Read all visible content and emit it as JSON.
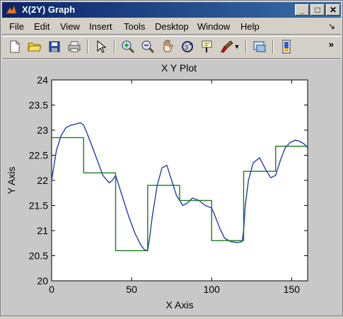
{
  "window": {
    "title": "X(2Y)  Graph",
    "controls": {
      "minimize": "_",
      "maximize": "□",
      "close": "✕"
    }
  },
  "menu": {
    "items": [
      "File",
      "Edit",
      "View",
      "Insert",
      "Tools",
      "Desktop",
      "Window",
      "Help"
    ],
    "dock_glyph": "↘"
  },
  "toolbar": {
    "icons": [
      "new-figure-icon",
      "open-file-icon",
      "save-icon",
      "print-icon",
      "pointer-icon",
      "zoom-in-icon",
      "zoom-out-icon",
      "pan-icon",
      "rotate-3d-icon",
      "data-cursor-icon",
      "brush-icon",
      "brush-dropdown-icon",
      "link-plot-icon",
      "insert-colorbar-icon"
    ],
    "overflow": "»"
  },
  "chart_data": {
    "type": "line",
    "title": "X Y Plot",
    "xlabel": "X Axis",
    "ylabel": "Y Axis",
    "xlim": [
      0,
      160
    ],
    "ylim": [
      20,
      24
    ],
    "xticks": [
      "0",
      "50",
      "100",
      "150"
    ],
    "xtick_values": [
      0,
      50,
      100,
      150
    ],
    "yticks": [
      "20",
      "20.5",
      "21",
      "21.5",
      "22",
      "22.5",
      "23",
      "23.5",
      "24"
    ],
    "ytick_values": [
      20,
      20.5,
      21,
      21.5,
      22,
      22.5,
      23,
      23.5,
      24
    ],
    "grid": false,
    "series": [
      {
        "color": "#1f3fb0",
        "x": [
          0,
          3,
          6,
          9,
          12,
          15,
          18,
          20,
          22,
          25,
          28,
          32,
          36,
          38,
          40,
          42,
          45,
          48,
          52,
          56,
          58,
          60,
          61,
          63,
          66,
          69,
          72,
          75,
          78,
          80,
          82,
          85,
          88,
          92,
          96,
          100,
          102,
          105,
          108,
          112,
          116,
          119,
          120,
          121,
          123,
          126,
          130,
          134,
          137,
          140,
          143,
          146,
          149,
          152,
          155,
          158,
          160
        ],
        "y": [
          22.0,
          22.6,
          22.9,
          23.05,
          23.1,
          23.12,
          23.15,
          23.1,
          22.95,
          22.7,
          22.45,
          22.1,
          21.95,
          22.0,
          22.1,
          21.9,
          21.6,
          21.3,
          20.95,
          20.7,
          20.62,
          20.6,
          20.8,
          21.3,
          21.9,
          22.25,
          22.3,
          22.0,
          21.7,
          21.6,
          21.5,
          21.55,
          21.65,
          21.6,
          21.5,
          21.45,
          21.3,
          21.05,
          20.85,
          20.78,
          20.76,
          20.78,
          21.0,
          21.5,
          22.0,
          22.35,
          22.45,
          22.2,
          22.05,
          22.1,
          22.4,
          22.65,
          22.75,
          22.8,
          22.78,
          22.72,
          22.65
        ]
      },
      {
        "color": "#1a7a1a",
        "x": [
          0,
          20,
          20,
          40,
          40,
          60,
          60,
          80,
          80,
          100,
          100,
          120,
          120,
          140,
          140,
          160
        ],
        "y": [
          22.85,
          22.85,
          22.15,
          22.15,
          20.6,
          20.6,
          21.9,
          21.9,
          21.6,
          21.6,
          20.8,
          20.8,
          22.18,
          22.18,
          22.68,
          22.68
        ]
      }
    ]
  }
}
